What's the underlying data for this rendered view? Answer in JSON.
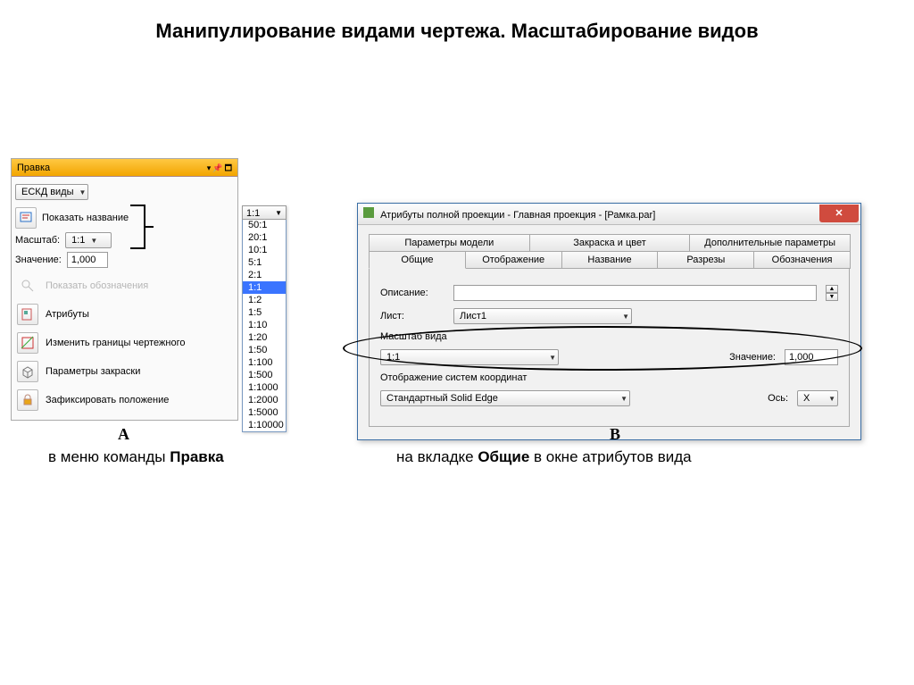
{
  "page_title": "Манипулирование видами чертежа. Масштабирование видов",
  "panelA": {
    "title": "Правка",
    "dropdown": "ЕСКД виды",
    "show_name": "Показать название",
    "scale_label": "Масштаб:",
    "scale_value": "1:1",
    "value_label": "Значение:",
    "value_input": "1,000",
    "disabled_row": "Показать обозначения",
    "rows": {
      "attrs": "Атрибуты",
      "bounds": "Изменить границы чертежного",
      "shading": "Параметры закраски",
      "lock": "Зафиксировать положение"
    }
  },
  "scale_popup": {
    "current": "1:1",
    "options": [
      "50:1",
      "20:1",
      "10:1",
      "5:1",
      "2:1",
      "1:1",
      "1:2",
      "1:5",
      "1:10",
      "1:20",
      "1:50",
      "1:100",
      "1:500",
      "1:1000",
      "1:2000",
      "1:5000",
      "1:10000"
    ],
    "selected": "1:1"
  },
  "dialogB": {
    "title": "Атрибуты полной проекции - Главная проекция - [Рамка.par]",
    "tabs_row1": [
      "Параметры модели",
      "Закраска и цвет",
      "Дополнительные параметры"
    ],
    "tabs_row2": [
      "Общие",
      "Отображение",
      "Название",
      "Разрезы",
      "Обозначения"
    ],
    "active_tab": "Общие",
    "desc_label": "Описание:",
    "desc_value": "",
    "sheet_label": "Лист:",
    "sheet_value": "Лист1",
    "scale_group": "Масштаб вида",
    "scale_value": "1:1",
    "value_label": "Значение:",
    "value_input": "1,000",
    "coord_group": "Отображение систем координат",
    "coord_value": "Стандартный Solid Edge",
    "axis_label": "Ось:",
    "axis_value": "X"
  },
  "captions": {
    "letter_a": "А",
    "letter_b": "В",
    "text_a_pre": "в меню команды ",
    "text_a_bold": "Правка",
    "text_b_pre": "на вкладке ",
    "text_b_bold": "Общие",
    "text_b_post": " в окне атрибутов вида"
  }
}
